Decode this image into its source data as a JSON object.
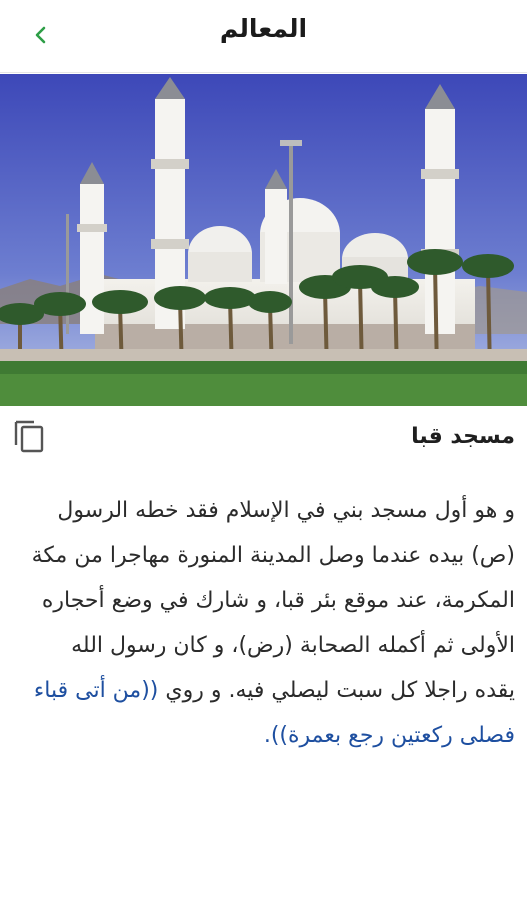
{
  "header": {
    "title": "المعالم",
    "back_icon": "chevron-left-icon"
  },
  "hero": {
    "image": "quba-mosque-photo"
  },
  "colors": {
    "accent": "#2e9e47",
    "link": "#1e4fa0"
  },
  "landmark": {
    "title": "مسجد قبا",
    "copy_icon": "copy-icon",
    "description": "و هو أول مسجد بني في الإسلام فقد خطه الرسول (ص) بيده عندما وصل المدينة المنورة مهاجرا من مكة المكرمة، عند موقع بئر قبا، و شارك في وضع أحجاره الأولى ثم أكمله الصحابة (رض)، و كان رسول الله يقده راجلا كل سبت ليصلي فيه. و روي ",
    "hadith": "((من أتى قباء فصلى ركعتين رجع بعمرة))."
  }
}
